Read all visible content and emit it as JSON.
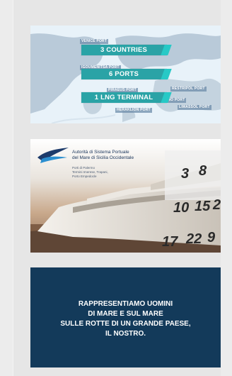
{
  "map_card": {
    "stats": [
      "3 COUNTRIES",
      "6 PORTS",
      "1 LNG TERMINAL"
    ],
    "port_labels": [
      "VENICE PORT",
      "IGOUMENITSA PORT",
      "PIRAEUS PORT",
      "RESTRIPOL PORT",
      "LIVORNO PORT",
      "HERAKLION PORT",
      "LIMASSOL PORT"
    ],
    "colors": {
      "pill": "#2aa3a6",
      "pill_tab": "#27c9c6",
      "sea": "#eaf3fa",
      "land": "#b7c8d6"
    }
  },
  "authority_card": {
    "title_lines": [
      "Autorità di Sistema Portuale",
      "del Mare di Sicilia Occidentale"
    ],
    "sub_lines": [
      "Porti di Palermo",
      "Termini Imerese, Trapani,",
      "Porto Empedocle"
    ],
    "calendar_numbers": [
      "3",
      "8",
      "10",
      "15",
      "2",
      "17",
      "22",
      "9"
    ]
  },
  "motto_card": {
    "lines": [
      "RAPPRESENTIAMO UOMINI",
      "DI MARE E SUL MARE",
      "SULLE ROTTE DI UN GRANDE PAESE,",
      "IL NOSTRO."
    ],
    "background": "#133a5a"
  }
}
